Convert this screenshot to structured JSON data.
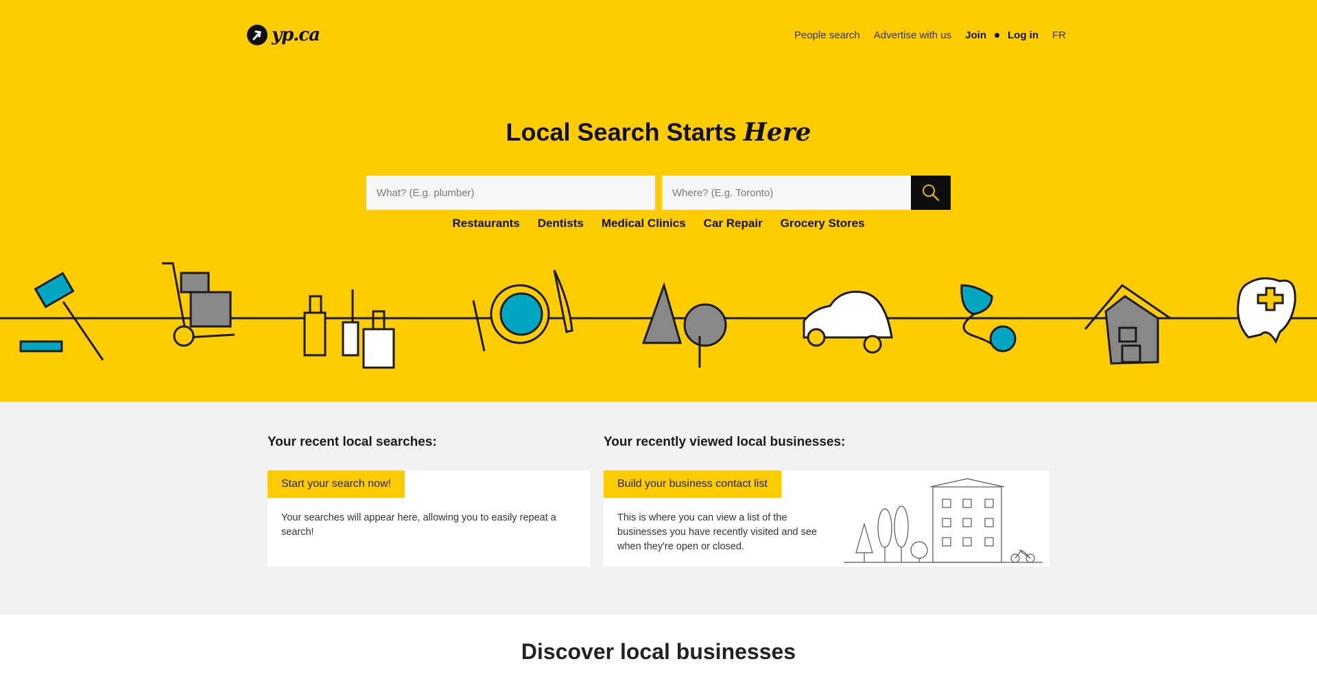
{
  "header": {
    "logo_text": "yp.ca",
    "nav": {
      "people_search": "People search",
      "advertise": "Advertise with us",
      "join": "Join",
      "login": "Log in",
      "language": "FR"
    }
  },
  "hero": {
    "headline_main": "Local Search Starts ",
    "headline_emphasis": "Here",
    "search": {
      "what_placeholder": "What? (E.g. plumber)",
      "where_placeholder": "Where? (E.g. Toronto)"
    },
    "quick_links": [
      "Restaurants",
      "Dentists",
      "Medical Clinics",
      "Car Repair",
      "Grocery Stores"
    ]
  },
  "recent": {
    "searches_title": "Your recent local searches:",
    "searches_tag": "Start your search now!",
    "searches_text": "Your searches will appear here, allowing you to easily repeat a search!",
    "businesses_title": "Your recently viewed local businesses:",
    "businesses_tag": "Build your business contact list",
    "businesses_text": "This is where you can view a list of the businesses you have recently visited and see when they're open or closed."
  },
  "discover_title": "Discover local businesses",
  "colors": {
    "brand_yellow": "#ffcc00",
    "accent_teal": "#00a6c2",
    "dark": "#111111"
  }
}
